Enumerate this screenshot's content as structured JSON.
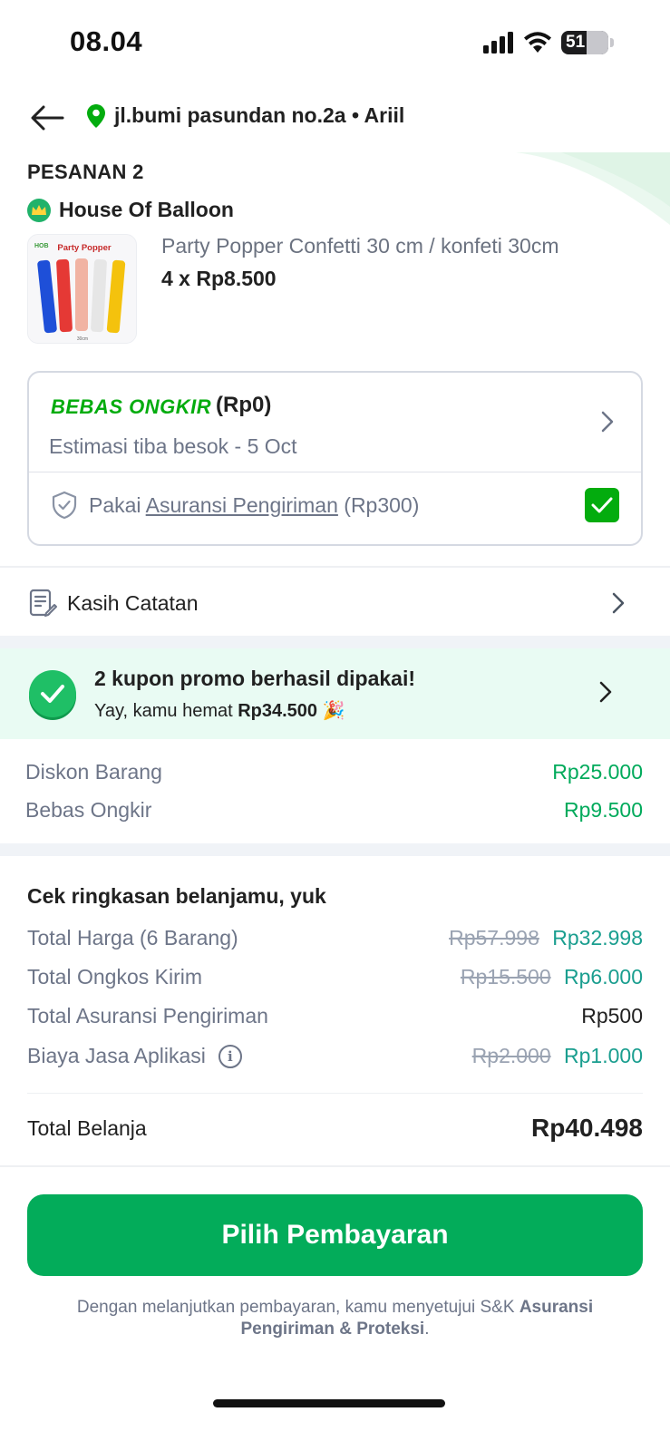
{
  "status_bar": {
    "time": "08.04",
    "battery": "51"
  },
  "header": {
    "address": "jl.bumi pasundan no.2a • Ariil"
  },
  "order": {
    "title": "PESANAN 2",
    "shop_name": "House Of Balloon",
    "product": {
      "image_label": "Party Popper",
      "image_brand": "HOB",
      "image_size": "30cm",
      "name": "Party Popper Confetti 30 cm / konfeti 30cm",
      "qty_price": "4 x Rp8.500"
    }
  },
  "shipping": {
    "logo_text": "BEBAS ONGKIR",
    "price": "(Rp0)",
    "estimate": "Estimasi tiba besok - 5 Oct",
    "insurance_prefix": "Pakai",
    "insurance_link": "Asuransi Pengiriman",
    "insurance_price": "(Rp300)",
    "insurance_checked": true
  },
  "notes": {
    "label": "Kasih Catatan"
  },
  "promo": {
    "title": "2 kupon promo berhasil dipakai!",
    "subtitle_prefix": "Yay, kamu hemat",
    "subtitle_amount": "Rp34.500",
    "emoji": "🎉"
  },
  "discounts": [
    {
      "label": "Diskon Barang",
      "value": "Rp25.000"
    },
    {
      "label": "Bebas Ongkir",
      "value": "Rp9.500"
    }
  ],
  "summary": {
    "title": "Cek ringkasan belanjamu, yuk",
    "rows": [
      {
        "label": "Total Harga (6 Barang)",
        "original": "Rp57.998",
        "value": "Rp32.998"
      },
      {
        "label": "Total Ongkos Kirim",
        "original": "Rp15.500",
        "value": "Rp6.000"
      },
      {
        "label": "Total Asuransi Pengiriman",
        "value": "Rp500"
      },
      {
        "label": "Biaya Jasa Aplikasi",
        "original": "Rp2.000",
        "value": "Rp1.000"
      }
    ],
    "total_label": "Total Belanja",
    "total_value": "Rp40.498"
  },
  "cta": {
    "label": "Pilih Pembayaran"
  },
  "disclaimer": {
    "text": "Dengan melanjutkan pembayaran, kamu menyetujui S&K",
    "bold": "Asuransi Pengiriman & Proteksi",
    "end": "."
  },
  "colors": {
    "primary": "#03ac5a",
    "discount": "#00aa5b",
    "promo_bg": "#e9fbf3"
  }
}
